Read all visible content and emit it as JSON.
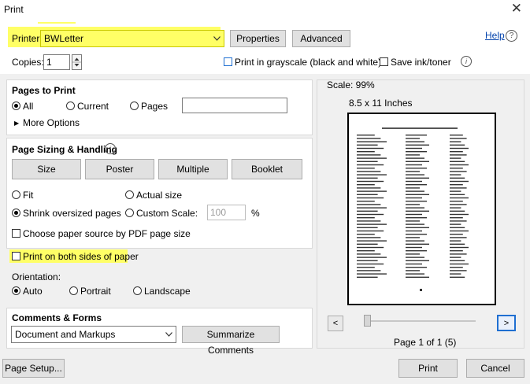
{
  "window": {
    "title": "Print",
    "close_glyph": "✕"
  },
  "printer": {
    "label": "Printer:",
    "selected": "BWLetter",
    "properties_label": "Properties",
    "advanced_label": "Advanced",
    "help_label": "Help",
    "help_glyph": "?"
  },
  "copies": {
    "label": "Copies:",
    "value": "1",
    "grayscale_label": "Print in grayscale (black and white)",
    "save_ink_label": "Save ink/toner",
    "info_glyph": "i"
  },
  "pages_to_print": {
    "heading": "Pages to Print",
    "all_label": "All",
    "current_label": "Current",
    "pages_label": "Pages",
    "pages_value": "",
    "more_options_label": "More Options",
    "selected": "All"
  },
  "sizing": {
    "heading": "Page Sizing & Handling",
    "tabs": [
      "Size",
      "Poster",
      "Multiple",
      "Booklet"
    ],
    "fit_label": "Fit",
    "actual_size_label": "Actual size",
    "shrink_label": "Shrink oversized pages",
    "custom_scale_label": "Custom Scale:",
    "custom_scale_value": "100",
    "percent_label": "%",
    "paper_source_label": "Choose paper source by PDF page size",
    "both_sides_label": "Print on both sides of paper",
    "selected": "Shrink oversized pages"
  },
  "orientation": {
    "label": "Orientation:",
    "auto_label": "Auto",
    "portrait_label": "Portrait",
    "landscape_label": "Landscape",
    "selected": "Auto"
  },
  "comments": {
    "heading": "Comments & Forms",
    "selected": "Document and Markups",
    "summarize_label": "Summarize Comments"
  },
  "preview": {
    "scale_label": "Scale:  99%",
    "paper_size_label": "8.5 x 11 Inches",
    "prev_glyph": "<",
    "next_glyph": ">",
    "page_indicator": "Page 1 of 1 (5)"
  },
  "footer": {
    "page_setup_label": "Page Setup...",
    "print_label": "Print",
    "cancel_label": "Cancel"
  },
  "colors": {
    "highlight": "#ffff66",
    "link": "#0645ad",
    "accent_blue": "#1f6fd1"
  }
}
